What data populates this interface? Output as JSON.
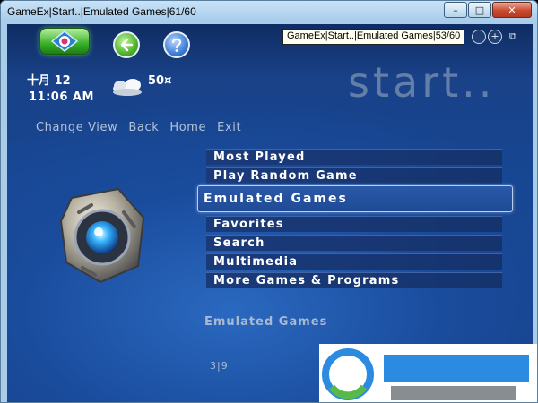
{
  "window": {
    "title": "GameEx|Start..|Emulated Games|61/60",
    "controls": {
      "minimize": "–",
      "maximize": "□",
      "close": "✕"
    }
  },
  "nav": {
    "tooltip": "GameEx|Start..|Emulated Games|53/60",
    "mini_plus": "+",
    "restore": "⧉"
  },
  "status": {
    "date": "十月 12",
    "time": "11:06 AM",
    "temperature": "50¤"
  },
  "big_title": "start..",
  "top_nav": [
    "Change View",
    "Back",
    "Home",
    "Exit"
  ],
  "menu": {
    "items_above": [
      "Most Played",
      "Play Random Game"
    ],
    "selected": "Emulated Games",
    "items_below": [
      "Favorites",
      "Search",
      "Multimedia",
      "More Games & Programs"
    ]
  },
  "footer": {
    "title": "Emulated Games",
    "page": "3|9"
  },
  "colors": {
    "background": "#1a4c9d",
    "menu_bar": "#1a3a7a",
    "selected_border": "#b9d0ee",
    "home_button": "#39b02a",
    "help_button": "#3f7fd6"
  }
}
